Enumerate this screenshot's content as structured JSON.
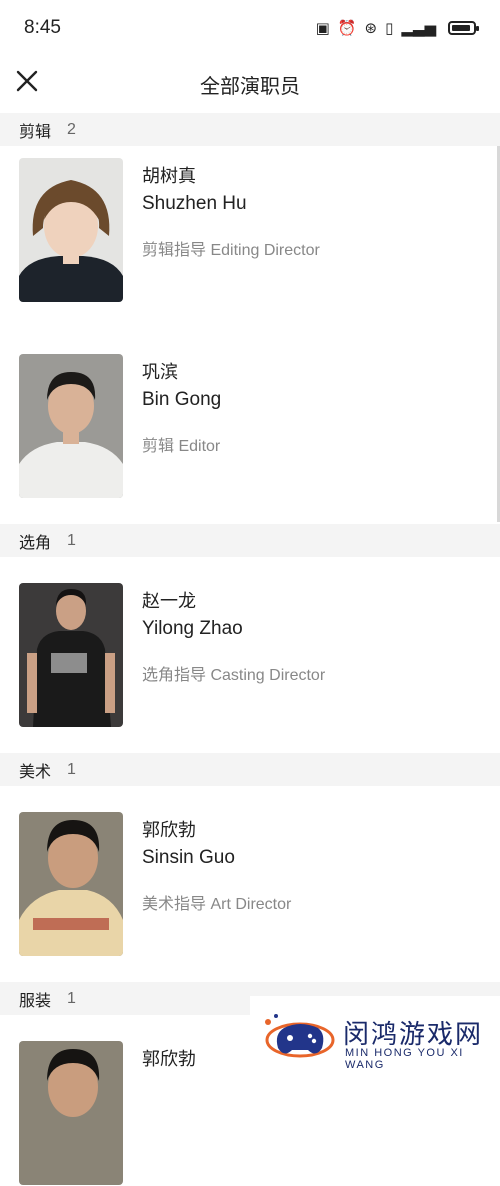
{
  "status_bar": {
    "time": "8:45"
  },
  "header": {
    "title": "全部演职员"
  },
  "sections": [
    {
      "name": "剪辑",
      "count": "2",
      "people": [
        {
          "name_cn": "胡树真",
          "name_en": "Shuzhen Hu",
          "role": "剪辑指导 Editing Director"
        },
        {
          "name_cn": "巩滨",
          "name_en": "Bin Gong",
          "role": "剪辑 Editor"
        }
      ]
    },
    {
      "name": "选角",
      "count": "1",
      "people": [
        {
          "name_cn": "赵一龙",
          "name_en": "Yilong Zhao",
          "role": "选角指导 Casting Director"
        }
      ]
    },
    {
      "name": "美术",
      "count": "1",
      "people": [
        {
          "name_cn": "郭欣勃",
          "name_en": "Sinsin Guo",
          "role": "美术指导 Art Director"
        }
      ]
    },
    {
      "name": "服装",
      "count": "1",
      "people": [
        {
          "name_cn": "郭欣勃"
        }
      ]
    }
  ],
  "watermark": {
    "name_cn": "闵鸿游戏网",
    "name_en": "MIN HONG YOU XI WANG"
  }
}
